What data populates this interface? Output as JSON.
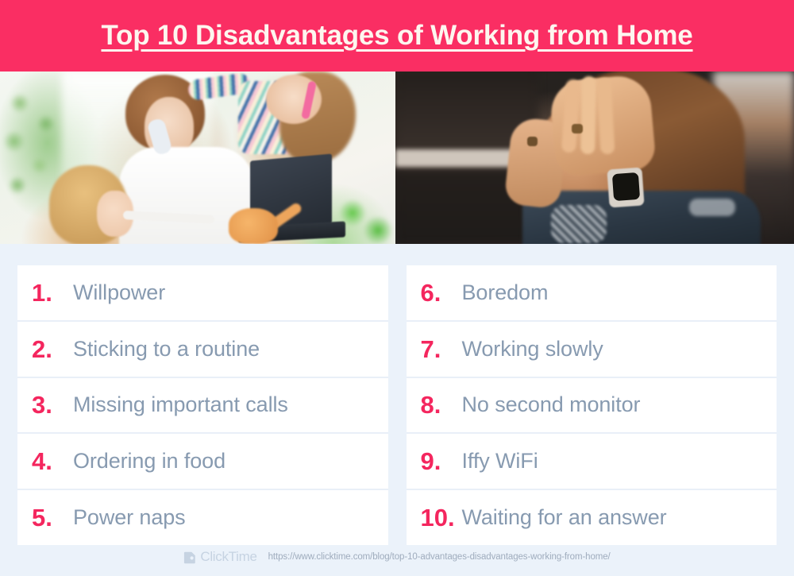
{
  "header": {
    "title": "Top 10 Disadvantages of Working from Home",
    "background_color": "#fa2e63",
    "title_color": "#fdf6ef"
  },
  "photos": [
    {
      "name": "mother-working-from-home-with-children",
      "description": "Woman on a cordless phone at a laptop while two young children and an orange kitten interrupt her in a bright living room"
    },
    {
      "name": "stressed-woman-holding-head",
      "description": "Dark moody photo of a woman in a denim jacket with both hands pressed to her forehead, wearing a smartwatch"
    }
  ],
  "list": {
    "accent_color": "#f4265e",
    "label_color": "#879ab0",
    "left_column": [
      {
        "number": "1.",
        "label": "Willpower"
      },
      {
        "number": "2.",
        "label": "Sticking to a routine"
      },
      {
        "number": "3.",
        "label": "Missing important calls"
      },
      {
        "number": "4.",
        "label": "Ordering in food"
      },
      {
        "number": "5.",
        "label": "Power naps"
      }
    ],
    "right_column": [
      {
        "number": "6.",
        "label": "Boredom"
      },
      {
        "number": "7.",
        "label": "Working slowly"
      },
      {
        "number": "8.",
        "label": "No second monitor"
      },
      {
        "number": "9.",
        "label": "Iffy WiFi"
      },
      {
        "number": "10.",
        "label": "Waiting for an answer"
      }
    ]
  },
  "footer": {
    "brand_name": "ClickTime",
    "brand_icon": "clicktime-logo-icon",
    "url": "https://www.clicktime.com/blog/top-10-advantages-disadvantages-working-from-home/"
  },
  "background_color": "#ebf2fa"
}
